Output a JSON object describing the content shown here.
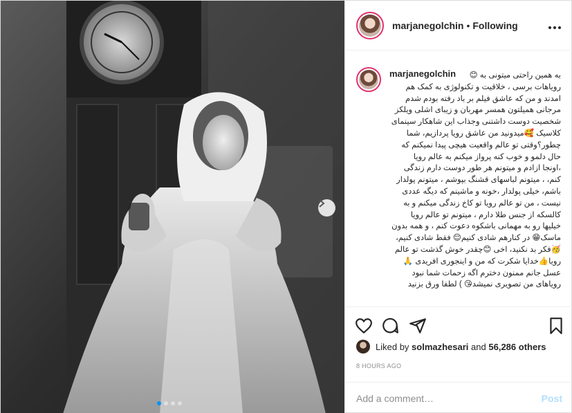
{
  "post": {
    "username": "marjanegolchin",
    "separator": "•",
    "follow_status": "Following",
    "more_icon": "more-horizontal-icon"
  },
  "caption": {
    "username": "marjanegolchin",
    "text": "به همین راحتی میتونی به 😊\nرویاهات برسی ، خلاقیت و تکنولوژی به کمک هم\nامدند و من که عاشق فیلم بر باد رفته بودم شدم\nمرجانی همیلتون همسر مهربان و زیبای اشلی ویلکز\nشخصیت دوست داشتنی وجذاب این شاهکار سینمای\nکلاسیک 🥰میدونید من عاشق رویا پردازیم، شما\nچطور؟وقتی تو عالم واقعیت هیچی پیدا نمیکنم که\nحال دلمو و خوب کنه پرواز میکنم به عالم رویا\n،اونجا ازادم و میتونم هر طور دوست دارم زندگی\nکنم، ، میتونم لباسهای قشنگ بپوشم ، میتونم پولدار\nباشم، خیلی پولدار ،خونه و ماشینم که دیگه عددی\nنیست ، من تو عالم رویا تو کاخ زندگی میکنم و به\nکالسکه از جنس طلا دارم ، میتونم تو عالم رویا\nخیلیها رو به مهمانی باشکوه دعوت کنم ، و همه بدون\nماسک😁 در کنارهم شادی کنیم😌 فقط شادی کنیم،\n🥳فکر بد نکنید، اخی 😊چقدر خوش گذشت تو عالم\nرویا👍خدایا شکرت که من و اینجوری افریدی 🙏\nعسل جانم ممنون دخترم اگه زحمات شما نبود\nرویاهای من تصویری نمیشد😘 ) لطفا ورق بزنید"
  },
  "actions": {
    "like_icon": "heart-icon",
    "comment_icon": "comment-icon",
    "share_icon": "share-icon",
    "save_icon": "bookmark-icon"
  },
  "likes": {
    "prefix": "Liked by",
    "first_user": "solmazhesari",
    "connector": "and",
    "others": "56,286 others"
  },
  "timestamp": "8 HOURS AGO",
  "comment": {
    "placeholder": "Add a comment…",
    "post_label": "Post"
  },
  "carousel": {
    "total": 4,
    "active": 1,
    "next_icon": "chevron-right-icon"
  },
  "colors": {
    "accent": "#0095f6",
    "post_disabled": "#b2dffc",
    "story_ring": "#e1306c",
    "muted": "#8e8e8e"
  }
}
